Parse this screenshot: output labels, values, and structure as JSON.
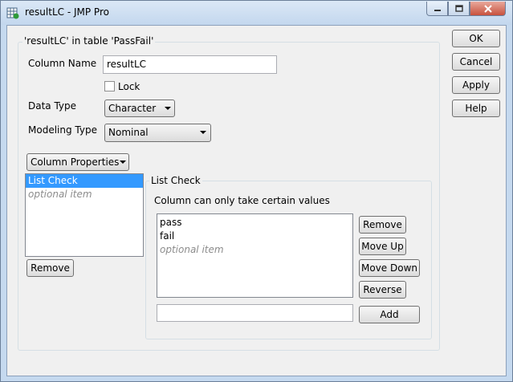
{
  "window": {
    "title": "resultLC - JMP Pro"
  },
  "titlebar_buttons": {
    "minimize": "minimize-icon",
    "maximize": "maximize-icon",
    "close": "close-icon"
  },
  "group": {
    "title": "'resultLC' in table 'PassFail'"
  },
  "fields": {
    "column_name_label": "Column Name",
    "column_name_value": "resultLC",
    "lock_label": "Lock",
    "data_type_label": "Data Type",
    "data_type_value": "Character",
    "modeling_type_label": "Modeling Type",
    "modeling_type_value": "Nominal"
  },
  "column_properties": {
    "button_label": "Column Properties",
    "list": [
      {
        "label": "List Check",
        "selected": true
      },
      {
        "label": "optional item",
        "placeholder": true
      }
    ],
    "remove_label": "Remove"
  },
  "list_check": {
    "title": "List Check",
    "description": "Column can only take certain values",
    "values": [
      {
        "label": "pass"
      },
      {
        "label": "fail"
      },
      {
        "label": "optional item",
        "placeholder": true
      }
    ],
    "remove_label": "Remove",
    "move_up_label": "Move Up",
    "move_down_label": "Move Down",
    "reverse_label": "Reverse",
    "add_label": "Add",
    "new_value": ""
  },
  "dialog_buttons": {
    "ok": "OK",
    "cancel": "Cancel",
    "apply": "Apply",
    "help": "Help"
  }
}
